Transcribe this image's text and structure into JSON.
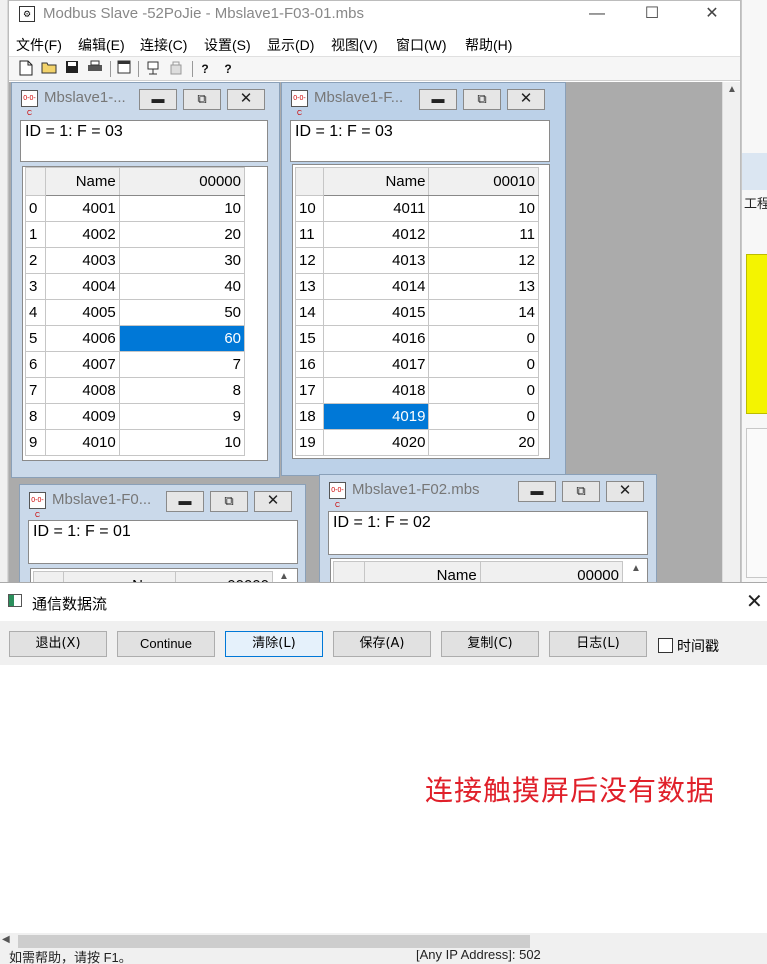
{
  "main": {
    "title": "Modbus Slave -52PoJie - Mbslave1-F03-01.mbs",
    "minimize_glyph": "—",
    "maximize_glyph": "☐",
    "close_glyph": "✕"
  },
  "menu": [
    {
      "label": "文件(F)"
    },
    {
      "label": "编辑(E)"
    },
    {
      "label": "连接(C)"
    },
    {
      "label": "设置(S)"
    },
    {
      "label": "显示(D)"
    },
    {
      "label": "视图(V)"
    },
    {
      "label": "窗口(W)"
    },
    {
      "label": "帮助(H)"
    }
  ],
  "toolbar": {
    "icons": [
      "new-icon",
      "open-icon",
      "save-icon",
      "print-icon",
      "window-icon",
      "connect-icon",
      "disconnect-icon",
      "help-icon",
      "context-help-icon"
    ],
    "help_glyph": "?",
    "context_help_glyph": "?"
  },
  "child_windows": {
    "w1": {
      "title": "Mbslave1-...",
      "header": "ID = 1: F = 03",
      "col_name": "Name",
      "col_value": "00000",
      "rows": [
        {
          "idx": "0",
          "name": "4001",
          "value": "10"
        },
        {
          "idx": "1",
          "name": "4002",
          "value": "20"
        },
        {
          "idx": "2",
          "name": "4003",
          "value": "30"
        },
        {
          "idx": "3",
          "name": "4004",
          "value": "40"
        },
        {
          "idx": "4",
          "name": "4005",
          "value": "50"
        },
        {
          "idx": "5",
          "name": "4006",
          "value": "60"
        },
        {
          "idx": "6",
          "name": "4007",
          "value": "7"
        },
        {
          "idx": "7",
          "name": "4008",
          "value": "8"
        },
        {
          "idx": "8",
          "name": "4009",
          "value": "9"
        },
        {
          "idx": "9",
          "name": "4010",
          "value": "10"
        }
      ]
    },
    "w2": {
      "title": "Mbslave1-F...",
      "header": "ID = 1: F = 03",
      "col_name": "Name",
      "col_value": "00010",
      "rows": [
        {
          "idx": "10",
          "name": "4011",
          "value": "10"
        },
        {
          "idx": "11",
          "name": "4012",
          "value": "11"
        },
        {
          "idx": "12",
          "name": "4013",
          "value": "12"
        },
        {
          "idx": "13",
          "name": "4014",
          "value": "13"
        },
        {
          "idx": "14",
          "name": "4015",
          "value": "14"
        },
        {
          "idx": "15",
          "name": "4016",
          "value": "0"
        },
        {
          "idx": "16",
          "name": "4017",
          "value": "0"
        },
        {
          "idx": "17",
          "name": "4018",
          "value": "0"
        },
        {
          "idx": "18",
          "name": "4019",
          "value": "0"
        },
        {
          "idx": "19",
          "name": "4020",
          "value": "20"
        }
      ]
    },
    "w3": {
      "title": "Mbslave1-F0...",
      "header": "ID = 1: F = 01",
      "col_name": "Name",
      "col_value": "00000"
    },
    "w4": {
      "title": "Mbslave1-F02.mbs",
      "header": "ID = 1: F = 02",
      "col_name": "Name",
      "col_value": "00000"
    }
  },
  "panel": {
    "title": "通信数据流",
    "close_glyph": "✕",
    "buttons": [
      {
        "label": "退出(X)"
      },
      {
        "label": "Continue"
      },
      {
        "label": "清除(L)"
      },
      {
        "label": "保存(A)"
      },
      {
        "label": "复制(C)"
      },
      {
        "label": "日志(L)"
      }
    ],
    "timestamp_label": "时间戳",
    "annotation": "连接触摸屏后没有数据"
  },
  "status": {
    "help": "如需帮助，请按 F1。",
    "address": "[Any IP Address]: 502"
  },
  "right_sliver": {
    "label": "工程"
  }
}
